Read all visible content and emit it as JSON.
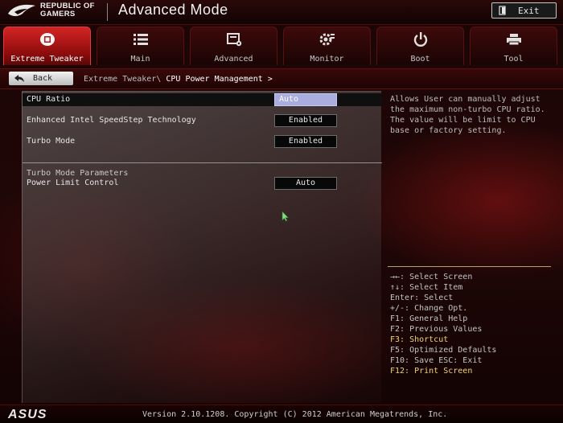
{
  "header": {
    "logo_line1": "REPUBLIC OF",
    "logo_line2": "GAMERS",
    "mode_title": "Advanced Mode",
    "exit_label": "Exit"
  },
  "tabs": [
    {
      "label": "Extreme Tweaker",
      "icon": "cpu-chip-icon",
      "active": true
    },
    {
      "label": "Main",
      "icon": "list-icon",
      "active": false
    },
    {
      "label": "Advanced",
      "icon": "advanced-settings-icon",
      "active": false
    },
    {
      "label": "Monitor",
      "icon": "gear-monitor-icon",
      "active": false
    },
    {
      "label": "Boot",
      "icon": "power-icon",
      "active": false
    },
    {
      "label": "Tool",
      "icon": "printer-tool-icon",
      "active": false
    }
  ],
  "breadcrumb": {
    "back_label": "Back",
    "path": "Extreme Tweaker\\",
    "current": "CPU Power Management >"
  },
  "settings": [
    {
      "label": "CPU Ratio",
      "value": "Auto",
      "selected": true
    },
    {
      "label": "Enhanced Intel SpeedStep Technology",
      "value": "Enabled",
      "selected": false
    },
    {
      "label": "Turbo Mode",
      "value": "Enabled",
      "selected": false
    }
  ],
  "section": {
    "title": "Turbo Mode Parameters",
    "power_limit_label": "Power Limit Control",
    "power_limit_value": "Auto"
  },
  "help": {
    "text": "Allows User can manually adjust the maximum non-turbo CPU ratio. The value will be limit to CPU base or factory setting."
  },
  "hotkeys": [
    {
      "text": "→←: Select Screen",
      "highlight": false
    },
    {
      "text": "↑↓: Select Item",
      "highlight": false
    },
    {
      "text": "Enter: Select",
      "highlight": false
    },
    {
      "text": "+/-: Change Opt.",
      "highlight": false
    },
    {
      "text": "F1: General Help",
      "highlight": false
    },
    {
      "text": "F2: Previous Values",
      "highlight": false
    },
    {
      "text": "F3: Shortcut",
      "highlight": true
    },
    {
      "text": "F5: Optimized Defaults",
      "highlight": false
    },
    {
      "text": "F10: Save  ESC: Exit",
      "highlight": false
    },
    {
      "text": "F12: Print Screen",
      "highlight": true
    }
  ],
  "footer": {
    "brand": "ASUS",
    "version": "Version 2.10.1208. Copyright (C) 2012 American Megatrends, Inc."
  },
  "colors": {
    "accent_red": "#c81e1e",
    "highlight_blue": "#a9aede",
    "hotkey_yellow": "#f0d36a"
  }
}
